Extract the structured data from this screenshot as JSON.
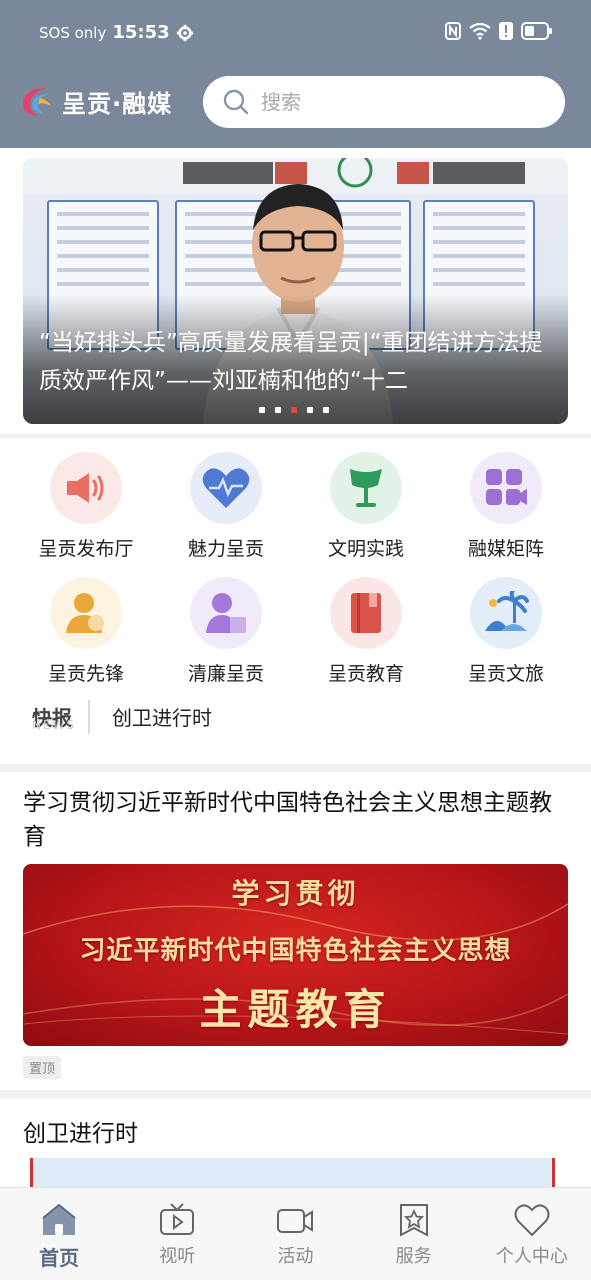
{
  "status_bar": {
    "carrier": "SOS only",
    "time": "15:53"
  },
  "brand": {
    "name": "呈贡·融媒"
  },
  "search": {
    "placeholder": "搜索"
  },
  "banner": {
    "title": "“当好排头兵”高质量发展看呈贡|“重团结讲方法提质效严作风”——刘亚楠和他的“十二",
    "active_dot": 3,
    "dot_count": 5
  },
  "grid": {
    "items": [
      {
        "label": "呈贡发布厅",
        "icon": "megaphone-icon"
      },
      {
        "label": "魅力呈贡",
        "icon": "heart-icon"
      },
      {
        "label": "文明实践",
        "icon": "flag-icon"
      },
      {
        "label": "融媒矩阵",
        "icon": "matrix-icon"
      },
      {
        "label": "呈贡先锋",
        "icon": "pioneer-icon"
      },
      {
        "label": "清廉呈贡",
        "icon": "integrity-icon"
      },
      {
        "label": "呈贡教育",
        "icon": "book-icon"
      },
      {
        "label": "呈贡文旅",
        "icon": "palm-tree-icon"
      }
    ]
  },
  "news_ticker": {
    "badge": "快报",
    "badge_ghost": "NEWS",
    "text": "创卫进行时"
  },
  "theme": {
    "title": "学习贯彻习近平新时代中国特色社会主义思想主题教育",
    "banner_line1": "学习贯彻",
    "banner_line2": "习近平新时代中国特色社会主义思想",
    "banner_line3": "主题教育",
    "pin_label": "置顶"
  },
  "next": {
    "title": "创卫进行时"
  },
  "tabs": [
    {
      "label": "首页",
      "icon": "home-icon",
      "active": true
    },
    {
      "label": "视听",
      "icon": "tv-icon",
      "active": false
    },
    {
      "label": "活动",
      "icon": "camera-icon",
      "active": false
    },
    {
      "label": "服务",
      "icon": "service-star-icon",
      "active": false
    },
    {
      "label": "个人中心",
      "icon": "heart-outline-icon",
      "active": false
    }
  ],
  "colors": {
    "header_bg": "#7b889c",
    "accent_red": "#e04a3a",
    "tab_active": "#5c6a83"
  }
}
